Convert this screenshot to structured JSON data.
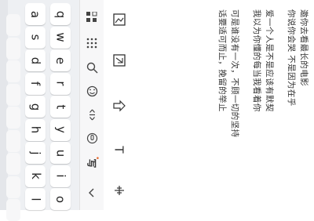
{
  "keyboard": {
    "rows": [
      [
        "q",
        "w",
        "e",
        "r",
        "t",
        "y",
        "u",
        "i",
        "o"
      ],
      [
        "a",
        "s",
        "d",
        "f",
        "g",
        "h",
        "j",
        "k",
        "l"
      ],
      [
        "",
        "",
        "",
        "",
        "",
        "",
        "",
        "",
        ""
      ]
    ]
  },
  "toolbar": {
    "icons": [
      "grid-icon",
      "keypad-icon",
      "search-icon",
      "emoji-icon",
      "cursor-move-icon",
      "voice-icon",
      "handwrite-icon",
      "collapse-icon"
    ],
    "handwrite_label": "写",
    "brand_mark": "•"
  },
  "tools": {
    "icons": [
      "image-icon",
      "photo-icon",
      "share-icon",
      "text-format-icon",
      "align-icon"
    ],
    "text_label": "T"
  },
  "content": {
    "paragraphs": [
      [
        "邀你去看最长的电影",
        "你说你会哭 不是因为在乎"
      ],
      [
        "爱一个人是不是应该有默契",
        "我以为你懂的每当我看着你"
      ],
      [
        "可是谁没有一次，不顾一切的坚持",
        "话要适可而止，挽留的举止"
      ]
    ]
  }
}
